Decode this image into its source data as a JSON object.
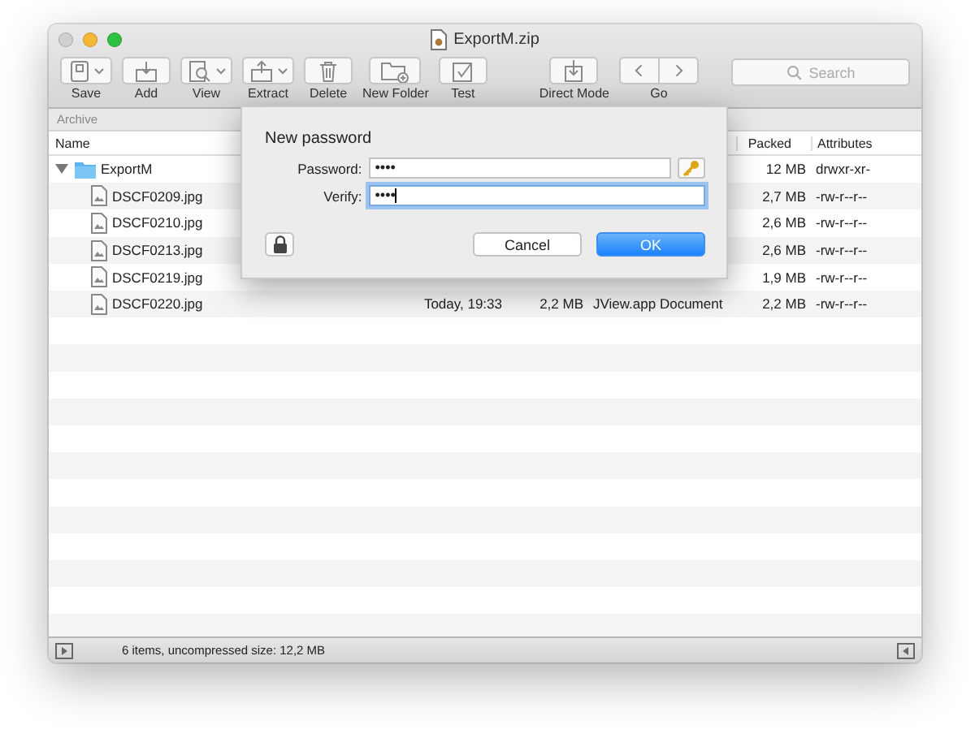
{
  "window": {
    "title": "ExportM.zip"
  },
  "toolbar": [
    {
      "label": "Save",
      "kind": "save",
      "dropdown": true
    },
    {
      "label": "Add",
      "kind": "add",
      "dropdown": false
    },
    {
      "label": "View",
      "kind": "view",
      "dropdown": true
    },
    {
      "label": "Extract",
      "kind": "extract",
      "dropdown": true
    },
    {
      "label": "Delete",
      "kind": "delete",
      "dropdown": false
    },
    {
      "label": "New Folder",
      "kind": "folder",
      "dropdown": false
    },
    {
      "label": "Test",
      "kind": "test",
      "dropdown": false
    },
    {
      "label": "Direct Mode",
      "kind": "direct",
      "dropdown": false
    },
    {
      "label": "Go",
      "kind": "go"
    }
  ],
  "search": {
    "placeholder": "Search"
  },
  "archive_header": "Archive",
  "table": {
    "columns": [
      "Name",
      "Packed",
      "Attributes"
    ],
    "rows": [
      {
        "name": "ExportM",
        "kind": "folder",
        "expanded": true,
        "packed": "12 MB",
        "attributes": "drwxr-xr-",
        "children": [
          {
            "name": "DSCF0209.jpg",
            "kind": "file",
            "packed": "2,7 MB",
            "attributes": "-rw-r--r--"
          },
          {
            "name": "DSCF0210.jpg",
            "kind": "file",
            "packed": "2,6 MB",
            "attributes": "-rw-r--r--"
          },
          {
            "name": "DSCF0213.jpg",
            "kind": "file",
            "packed": "2,6 MB",
            "attributes": "-rw-r--r--"
          },
          {
            "name": "DSCF0219.jpg",
            "kind": "file",
            "packed": "1,9 MB",
            "attributes": "-rw-r--r--"
          },
          {
            "name": "DSCF0220.jpg",
            "kind": "file",
            "date": "Today, 19:33",
            "size": "2,2 MB",
            "type": "JView.app Document",
            "packed": "2,2 MB",
            "attributes": "-rw-r--r--"
          }
        ]
      }
    ]
  },
  "dialog": {
    "title": "New password",
    "fields": [
      {
        "label": "Password:",
        "value": "••••",
        "focused": false,
        "key_button": true
      },
      {
        "label": "Verify:",
        "value": "••••",
        "focused": true,
        "key_button": false
      }
    ],
    "buttons": [
      {
        "label": "Cancel",
        "default": false
      },
      {
        "label": "OK",
        "default": true
      }
    ]
  },
  "status_bar": "6 items, uncompressed size: 12,2 MB"
}
